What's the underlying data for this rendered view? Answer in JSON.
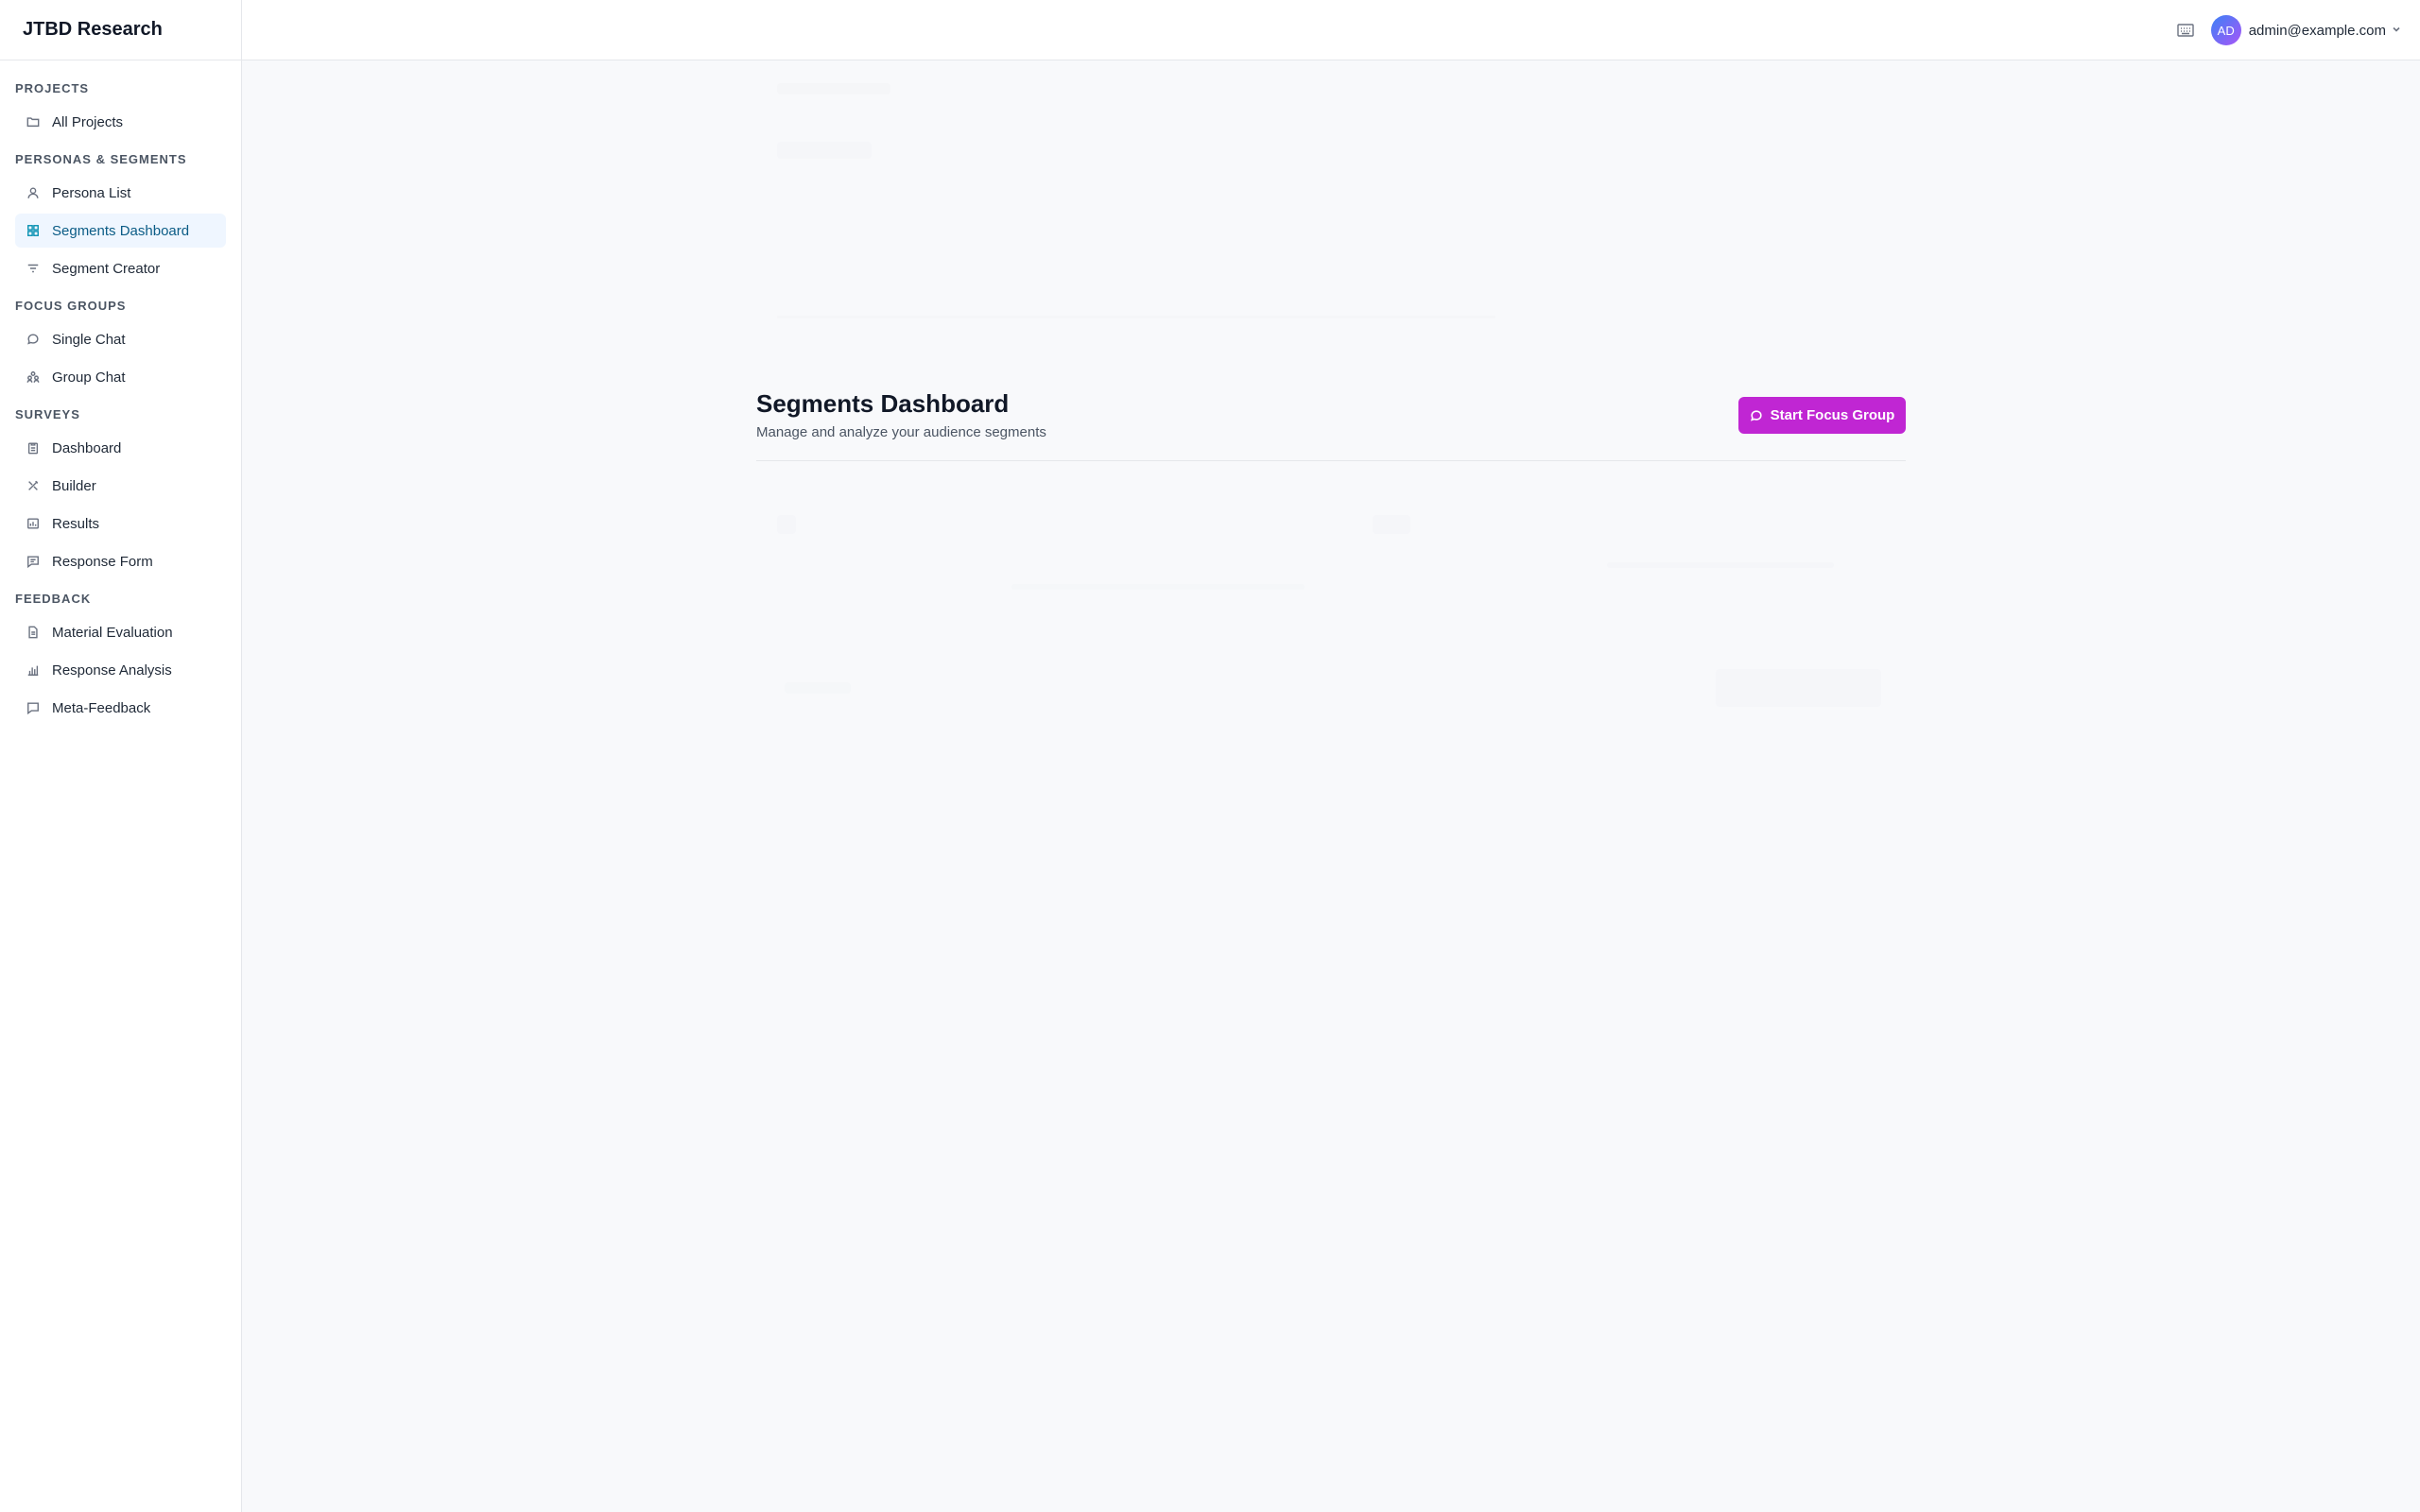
{
  "app": {
    "title": "JTBD Research"
  },
  "header": {
    "user_initials": "AD",
    "user_email": "admin@example.com"
  },
  "sidebar": {
    "sections": [
      {
        "title": "PROJECTS",
        "items": [
          {
            "label": "All Projects",
            "icon": "folder-icon"
          }
        ]
      },
      {
        "title": "PERSONAS & SEGMENTS",
        "items": [
          {
            "label": "Persona List",
            "icon": "user-icon"
          },
          {
            "label": "Segments Dashboard",
            "icon": "grid-icon",
            "active": true
          },
          {
            "label": "Segment Creator",
            "icon": "filter-icon"
          }
        ]
      },
      {
        "title": "FOCUS GROUPS",
        "items": [
          {
            "label": "Single Chat",
            "icon": "chat-icon"
          },
          {
            "label": "Group Chat",
            "icon": "users-icon"
          }
        ]
      },
      {
        "title": "SURVEYS",
        "items": [
          {
            "label": "Dashboard",
            "icon": "clipboard-icon"
          },
          {
            "label": "Builder",
            "icon": "tools-icon"
          },
          {
            "label": "Results",
            "icon": "chart-icon"
          },
          {
            "label": "Response Form",
            "icon": "form-icon"
          }
        ]
      },
      {
        "title": "FEEDBACK",
        "items": [
          {
            "label": "Material Evaluation",
            "icon": "document-icon"
          },
          {
            "label": "Response Analysis",
            "icon": "bar-chart-icon"
          },
          {
            "label": "Meta-Feedback",
            "icon": "message-icon"
          }
        ]
      }
    ]
  },
  "main": {
    "title": "Segments Dashboard",
    "subtitle": "Manage and analyze your audience segments",
    "cta_label": "Start Focus Group"
  },
  "colors": {
    "accent": "#c026d3",
    "active_bg": "#eff6ff",
    "active_text": "#0b5c86"
  }
}
